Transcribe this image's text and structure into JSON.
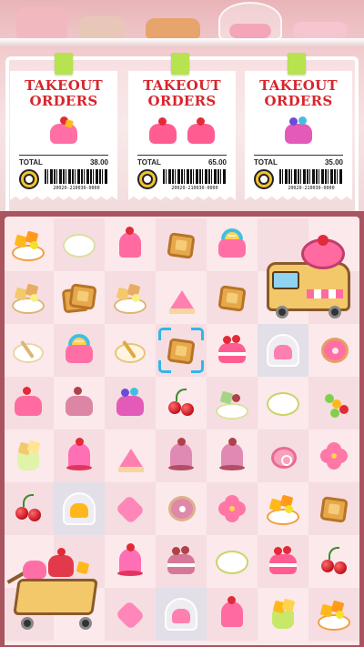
{
  "orders": [
    {
      "title_line1": "TAKEOUT",
      "title_line2": "ORDERS",
      "total_label": "TOTAL",
      "total_value": "38.00",
      "barcode": "20020-210030-0000",
      "items": [
        "rainbow-mango-cake"
      ]
    },
    {
      "title_line1": "TAKEOUT",
      "title_line2": "ORDERS",
      "total_label": "TOTAL",
      "total_value": "65.00",
      "barcode": "20020-210030-0000",
      "items": [
        "strawberry-heart-cake",
        "strawberry-heart-cake"
      ]
    },
    {
      "title_line1": "TAKEOUT",
      "title_line2": "ORDERS",
      "total_label": "TOTAL",
      "total_value": "35.00",
      "barcode": "20020-210030-0000",
      "items": [
        "rainbow-berry-cake"
      ]
    }
  ],
  "colors": {
    "ticket_title": "#d7262c",
    "tape": "#b6e34f",
    "board_border": "#a85560",
    "board_bg": "#fbe9ec",
    "selection": "#2fb7ea"
  },
  "board": {
    "selected_cell": [
      3,
      2
    ],
    "rows": [
      [
        "mango-fruit-plate",
        "empty-plate",
        "pink-pudding",
        "square-tart",
        "rainbow-cake",
        null,
        null
      ],
      [
        "mango-fruit-plate",
        "square-tart-stack",
        "mango-fruit-plate",
        "strawberry-slice",
        "square-tart",
        null,
        null
      ],
      [
        "spoon-plate",
        "rainbow-cake",
        "spoon-plate",
        "square-tart",
        "cherry-layer-cake",
        "glass-dome-cake",
        "sprinkle-donut"
      ],
      [
        "strawberry-cake",
        "strawberry-cake",
        "rainbow-berry-cake",
        "cherries",
        "fruit-tart-plate",
        "empty-plate",
        "grape-skewer"
      ],
      [
        "mango-cube-cup",
        "strawberry-pudding",
        "strawberry-slice",
        "strawberry-pudding",
        "strawberry-pudding",
        "strawberry-roll",
        "flower-cookie"
      ],
      [
        "cherries",
        "glass-dome-mango",
        "heart-cake",
        "sprinkle-donut",
        "flower-cookie",
        "mango-fruit-plate",
        "square-tart"
      ],
      [
        null,
        null,
        "strawberry-pudding",
        "cherry-layer-cake",
        "empty-plate",
        "cherry-layer-cake",
        "cherries"
      ],
      [
        null,
        null,
        "heart-cake",
        "glass-dome-roll",
        "pink-pudding",
        "mango-cube-cup",
        "mango-fruit-plate"
      ]
    ],
    "big_items": [
      "food-truck",
      "dessert-cart"
    ]
  }
}
